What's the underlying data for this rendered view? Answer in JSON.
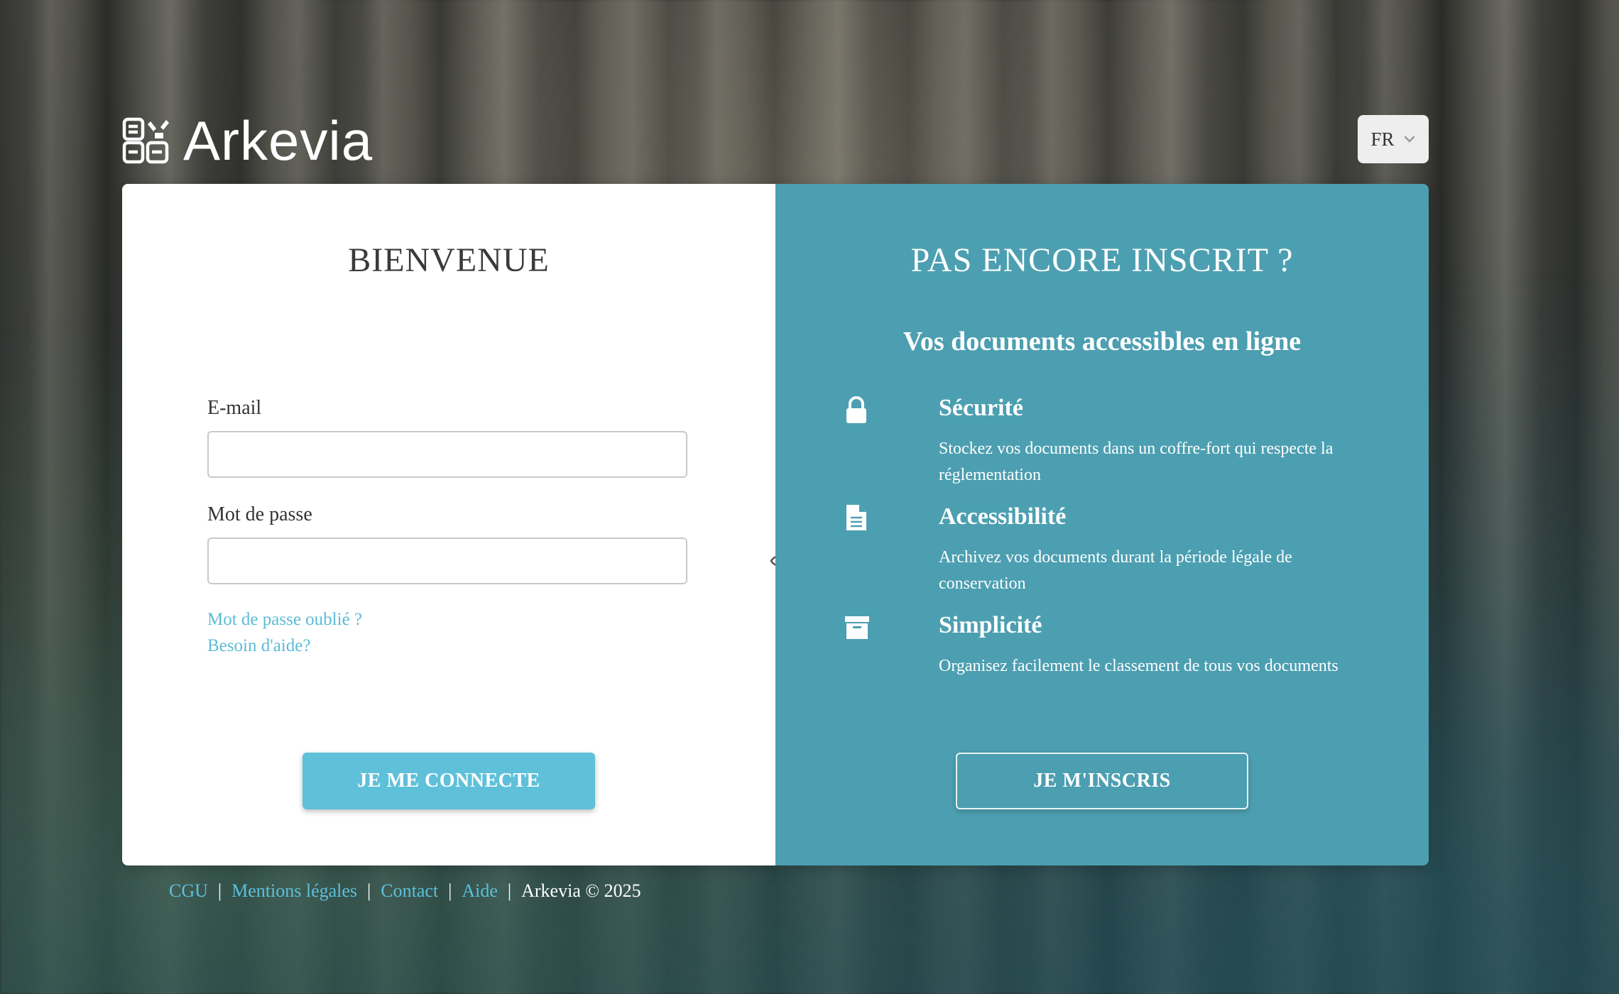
{
  "brand": {
    "name": "Arkevia",
    "icon": "arkevia-logo-icon"
  },
  "language": {
    "selected": "FR",
    "icon": "chevron-down-icon"
  },
  "login": {
    "title": "BIENVENUE",
    "email_label": "E-mail",
    "email_value": "",
    "password_label": "Mot de passe",
    "password_value": "",
    "password_toggle_icon": "eye-icon",
    "forgot_password": "Mot de passe oublié ?",
    "need_help": "Besoin d'aide?",
    "submit_label": "JE ME CONNECTE"
  },
  "register": {
    "title": "PAS ENCORE INSCRIT ?",
    "subtitle": "Vos documents accessibles en ligne",
    "features": [
      {
        "icon": "lock-icon",
        "title": "Sécurité",
        "description": "Stockez vos documents dans un coffre-fort qui respecte la réglementation"
      },
      {
        "icon": "document-icon",
        "title": "Accessibilité",
        "description": "Archivez vos documents durant la période légale de conservation"
      },
      {
        "icon": "archive-box-icon",
        "title": "Simplicité",
        "description": "Organisez facilement le classement de tous vos documents"
      }
    ],
    "submit_label": "JE M'INSCRIS"
  },
  "footer": {
    "links": [
      "CGU",
      "Mentions légales",
      "Contact",
      "Aide"
    ],
    "separator": "|",
    "copyright": "Arkevia © 2025"
  },
  "colors": {
    "accent": "#5fc0da",
    "panel_right": "#4c9fb1",
    "link": "#5bbcd6"
  }
}
